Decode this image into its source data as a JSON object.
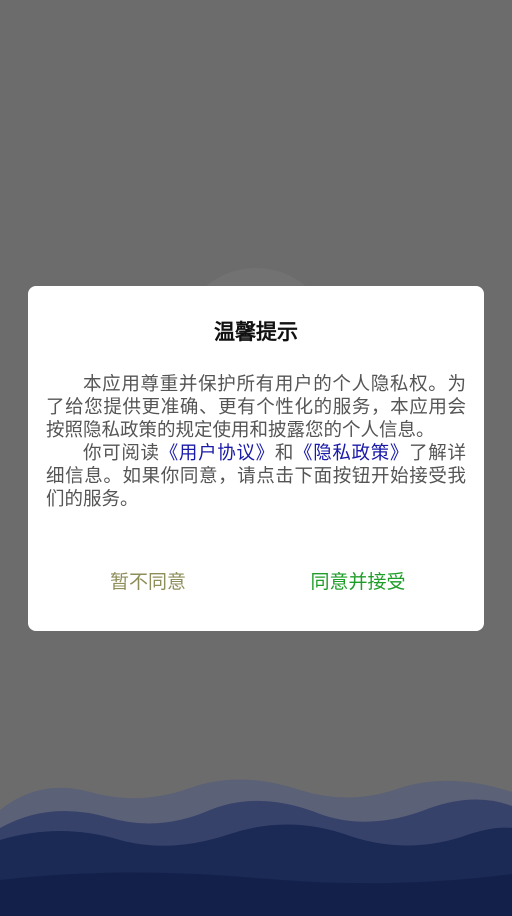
{
  "dialog": {
    "title": "温馨提示",
    "paragraph1": "本应用尊重并保护所有用户的个人隐私权。为了给您提供更准确、更有个性化的服务，本应用会按照隐私政策的规定使用和披露您的个人信息。",
    "paragraph2_prefix": "你可阅读",
    "user_agreement_link": "《用户协议》",
    "paragraph2_and": "和",
    "privacy_policy_link": "《隐私政策》",
    "paragraph2_suffix": "了解详细信息。如果你同意，请点击下面按钮开始接受我们的服务。",
    "decline_label": "暂不同意",
    "accept_label": "同意并接受"
  },
  "colors": {
    "overlay": "#6c6c6c",
    "link": "#1a1aa8",
    "decline": "#8e8e5a",
    "accept": "#1e9e28",
    "wave": "#1a2a55"
  }
}
